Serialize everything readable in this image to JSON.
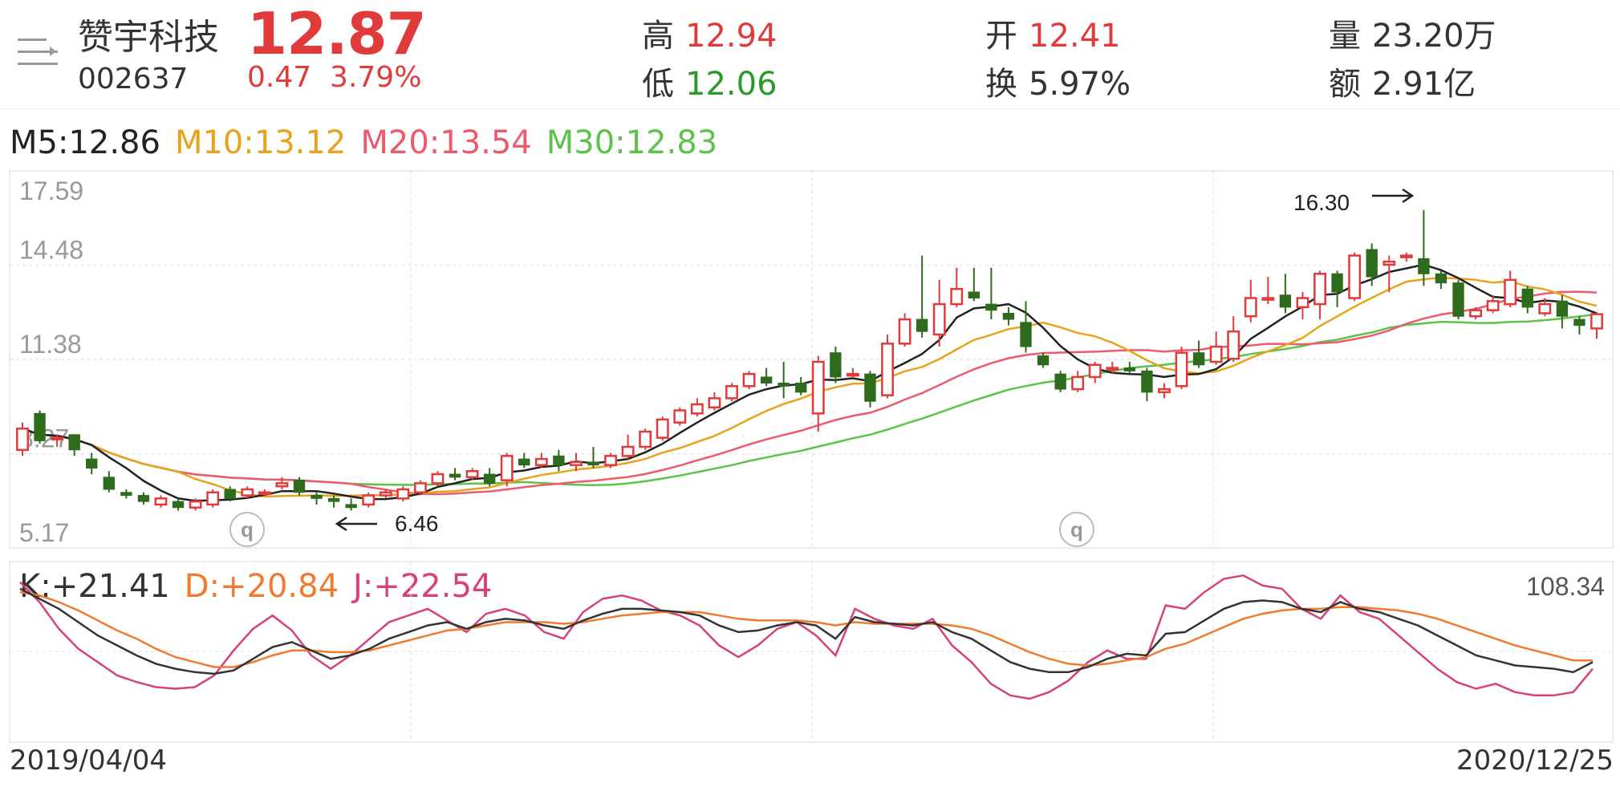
{
  "header": {
    "stock_name": "赞宇科技",
    "stock_code": "002637",
    "price": "12.87",
    "change": "0.47",
    "change_pct": "3.79%",
    "high_label": "高",
    "high": "12.94",
    "low_label": "低",
    "low": "12.06",
    "open_label": "开",
    "open": "12.41",
    "turnover_label": "换",
    "turnover": "5.97%",
    "volume_label": "量",
    "volume": "23.20万",
    "amount_label": "额",
    "amount": "2.91亿"
  },
  "ma_legend": {
    "m5": "M5:12.86",
    "m10": "M10:13.12",
    "m20": "M20:13.54",
    "m30": "M30:12.83"
  },
  "kdj_legend": {
    "k": "K:+21.41",
    "d": "D:+20.84",
    "j": "J:+22.54",
    "max": "108.34"
  },
  "dates": {
    "start": "2019/04/04",
    "end": "2020/12/25"
  },
  "annotations": {
    "high_mark": "16.30",
    "low_mark": "6.46",
    "q_badge": "q"
  },
  "colors": {
    "up": "#e03a3a",
    "down": "#2e6b1d",
    "m5": "#222222",
    "m10": "#e8a21c",
    "m20": "#ee5a6d",
    "m30": "#5cc24a",
    "k": "#333333",
    "d": "#f07a30",
    "j": "#d6407c"
  },
  "chart_data": {
    "type": "candlestick",
    "y_ticks": [
      "17.59",
      "14.48",
      "11.38",
      "8.27",
      "5.17"
    ],
    "ylim": [
      5.17,
      17.59
    ],
    "x_range": [
      "2019/04/04",
      "2020/12/25"
    ],
    "candles": [
      {
        "o": 8.4,
        "c": 9.1,
        "h": 9.3,
        "l": 8.2
      },
      {
        "o": 9.6,
        "c": 8.7,
        "h": 9.7,
        "l": 8.6
      },
      {
        "o": 8.8,
        "c": 8.8,
        "h": 8.9,
        "l": 8.5
      },
      {
        "o": 8.9,
        "c": 8.4,
        "h": 8.9,
        "l": 8.2
      },
      {
        "o": 8.1,
        "c": 7.8,
        "h": 8.3,
        "l": 7.6
      },
      {
        "o": 7.5,
        "c": 7.1,
        "h": 7.7,
        "l": 7.0
      },
      {
        "o": 7.0,
        "c": 6.9,
        "h": 7.1,
        "l": 6.8
      },
      {
        "o": 6.9,
        "c": 6.7,
        "h": 7.0,
        "l": 6.6
      },
      {
        "o": 6.6,
        "c": 6.8,
        "h": 6.9,
        "l": 6.5
      },
      {
        "o": 6.7,
        "c": 6.5,
        "h": 6.8,
        "l": 6.4
      },
      {
        "o": 6.5,
        "c": 6.7,
        "h": 6.8,
        "l": 6.4
      },
      {
        "o": 6.6,
        "c": 7.0,
        "h": 7.1,
        "l": 6.5
      },
      {
        "o": 7.1,
        "c": 6.8,
        "h": 7.2,
        "l": 6.7
      },
      {
        "o": 6.9,
        "c": 7.1,
        "h": 7.2,
        "l": 6.8
      },
      {
        "o": 7.0,
        "c": 7.0,
        "h": 7.1,
        "l": 6.9
      },
      {
        "o": 7.2,
        "c": 7.3,
        "h": 7.5,
        "l": 7.1
      },
      {
        "o": 7.4,
        "c": 7.0,
        "h": 7.5,
        "l": 6.9
      },
      {
        "o": 6.9,
        "c": 6.8,
        "h": 7.0,
        "l": 6.6
      },
      {
        "o": 6.8,
        "c": 6.7,
        "h": 6.9,
        "l": 6.5
      },
      {
        "o": 6.6,
        "c": 6.5,
        "h": 6.8,
        "l": 6.4
      },
      {
        "o": 6.6,
        "c": 6.9,
        "h": 7.0,
        "l": 6.5
      },
      {
        "o": 6.9,
        "c": 7.0,
        "h": 7.1,
        "l": 6.8
      },
      {
        "o": 6.8,
        "c": 7.1,
        "h": 7.2,
        "l": 6.7
      },
      {
        "o": 7.0,
        "c": 7.3,
        "h": 7.4,
        "l": 6.9
      },
      {
        "o": 7.3,
        "c": 7.6,
        "h": 7.7,
        "l": 7.2
      },
      {
        "o": 7.6,
        "c": 7.5,
        "h": 7.8,
        "l": 7.4
      },
      {
        "o": 7.5,
        "c": 7.7,
        "h": 7.8,
        "l": 7.4
      },
      {
        "o": 7.6,
        "c": 7.3,
        "h": 7.8,
        "l": 7.2
      },
      {
        "o": 7.4,
        "c": 8.2,
        "h": 8.3,
        "l": 7.2
      },
      {
        "o": 8.1,
        "c": 7.9,
        "h": 8.3,
        "l": 7.8
      },
      {
        "o": 7.9,
        "c": 8.1,
        "h": 8.3,
        "l": 7.8
      },
      {
        "o": 8.2,
        "c": 7.9,
        "h": 8.4,
        "l": 7.7
      },
      {
        "o": 7.9,
        "c": 8.0,
        "h": 8.3,
        "l": 7.7
      },
      {
        "o": 8.0,
        "c": 7.9,
        "h": 8.5,
        "l": 7.8
      },
      {
        "o": 7.9,
        "c": 8.2,
        "h": 8.3,
        "l": 7.8
      },
      {
        "o": 8.2,
        "c": 8.5,
        "h": 8.9,
        "l": 8.1
      },
      {
        "o": 8.5,
        "c": 9.0,
        "h": 9.1,
        "l": 8.4
      },
      {
        "o": 8.8,
        "c": 9.4,
        "h": 9.5,
        "l": 8.7
      },
      {
        "o": 9.3,
        "c": 9.7,
        "h": 9.8,
        "l": 9.2
      },
      {
        "o": 9.6,
        "c": 9.9,
        "h": 10.1,
        "l": 9.5
      },
      {
        "o": 9.8,
        "c": 10.1,
        "h": 10.3,
        "l": 9.7
      },
      {
        "o": 10.1,
        "c": 10.5,
        "h": 10.6,
        "l": 10.0
      },
      {
        "o": 10.5,
        "c": 10.9,
        "h": 11.0,
        "l": 10.4
      },
      {
        "o": 10.8,
        "c": 10.6,
        "h": 11.1,
        "l": 10.5
      },
      {
        "o": 10.6,
        "c": 10.5,
        "h": 11.3,
        "l": 10.1
      },
      {
        "o": 10.6,
        "c": 10.3,
        "h": 10.8,
        "l": 10.2
      },
      {
        "o": 9.6,
        "c": 11.3,
        "h": 11.5,
        "l": 9.0
      },
      {
        "o": 11.6,
        "c": 10.8,
        "h": 11.8,
        "l": 10.6
      },
      {
        "o": 10.9,
        "c": 10.9,
        "h": 11.1,
        "l": 10.8
      },
      {
        "o": 10.9,
        "c": 10.0,
        "h": 11.0,
        "l": 9.8
      },
      {
        "o": 10.2,
        "c": 11.9,
        "h": 12.2,
        "l": 10.1
      },
      {
        "o": 11.9,
        "c": 12.7,
        "h": 12.9,
        "l": 11.8
      },
      {
        "o": 12.7,
        "c": 12.3,
        "h": 14.8,
        "l": 12.1
      },
      {
        "o": 12.2,
        "c": 13.2,
        "h": 14.0,
        "l": 11.8
      },
      {
        "o": 13.2,
        "c": 13.7,
        "h": 14.4,
        "l": 13.1
      },
      {
        "o": 13.6,
        "c": 13.4,
        "h": 14.4,
        "l": 13.3
      },
      {
        "o": 13.2,
        "c": 13.0,
        "h": 14.4,
        "l": 12.7
      },
      {
        "o": 12.9,
        "c": 12.7,
        "h": 13.1,
        "l": 12.5
      },
      {
        "o": 12.6,
        "c": 11.8,
        "h": 13.3,
        "l": 11.6
      },
      {
        "o": 11.5,
        "c": 11.2,
        "h": 11.6,
        "l": 11.1
      },
      {
        "o": 10.9,
        "c": 10.4,
        "h": 11.0,
        "l": 10.3
      },
      {
        "o": 10.4,
        "c": 10.8,
        "h": 11.0,
        "l": 10.3
      },
      {
        "o": 10.8,
        "c": 11.2,
        "h": 11.3,
        "l": 10.6
      },
      {
        "o": 11.1,
        "c": 11.1,
        "h": 11.3,
        "l": 10.9
      },
      {
        "o": 11.1,
        "c": 11.0,
        "h": 11.3,
        "l": 10.9
      },
      {
        "o": 11.0,
        "c": 10.3,
        "h": 11.1,
        "l": 10.0
      },
      {
        "o": 10.3,
        "c": 10.4,
        "h": 10.6,
        "l": 10.1
      },
      {
        "o": 10.5,
        "c": 11.6,
        "h": 11.8,
        "l": 10.4
      },
      {
        "o": 11.6,
        "c": 11.2,
        "h": 12.0,
        "l": 11.1
      },
      {
        "o": 11.3,
        "c": 11.8,
        "h": 12.3,
        "l": 11.2
      },
      {
        "o": 11.4,
        "c": 12.3,
        "h": 12.8,
        "l": 11.3
      },
      {
        "o": 12.8,
        "c": 13.4,
        "h": 14.0,
        "l": 12.6
      },
      {
        "o": 13.4,
        "c": 13.4,
        "h": 14.1,
        "l": 13.2
      },
      {
        "o": 13.5,
        "c": 13.1,
        "h": 14.2,
        "l": 12.9
      },
      {
        "o": 13.1,
        "c": 13.4,
        "h": 13.6,
        "l": 12.7
      },
      {
        "o": 13.2,
        "c": 14.2,
        "h": 14.3,
        "l": 12.7
      },
      {
        "o": 14.2,
        "c": 13.6,
        "h": 14.3,
        "l": 13.1
      },
      {
        "o": 13.4,
        "c": 14.8,
        "h": 14.9,
        "l": 13.3
      },
      {
        "o": 15.0,
        "c": 14.1,
        "h": 15.2,
        "l": 13.8
      },
      {
        "o": 14.5,
        "c": 14.6,
        "h": 14.8,
        "l": 13.6
      },
      {
        "o": 14.8,
        "c": 14.8,
        "h": 14.9,
        "l": 14.6
      },
      {
        "o": 14.7,
        "c": 14.2,
        "h": 16.3,
        "l": 13.8
      },
      {
        "o": 14.2,
        "c": 13.9,
        "h": 14.3,
        "l": 13.7
      },
      {
        "o": 13.9,
        "c": 12.8,
        "h": 14.0,
        "l": 12.7
      },
      {
        "o": 12.8,
        "c": 13.0,
        "h": 13.1,
        "l": 12.7
      },
      {
        "o": 13.0,
        "c": 13.3,
        "h": 13.5,
        "l": 12.9
      },
      {
        "o": 13.2,
        "c": 14.0,
        "h": 14.3,
        "l": 13.1
      },
      {
        "o": 13.7,
        "c": 13.1,
        "h": 13.8,
        "l": 12.9
      },
      {
        "o": 12.9,
        "c": 13.2,
        "h": 13.4,
        "l": 12.8
      },
      {
        "o": 13.3,
        "c": 12.8,
        "h": 13.5,
        "l": 12.4
      },
      {
        "o": 12.7,
        "c": 12.5,
        "h": 12.8,
        "l": 12.2
      },
      {
        "o": 12.4,
        "c": 12.87,
        "h": 12.94,
        "l": 12.06
      }
    ],
    "kdj": {
      "k": [
        92,
        86,
        80,
        72,
        64,
        58,
        52,
        47,
        44,
        42,
        41,
        43,
        50,
        57,
        60,
        55,
        50,
        52,
        56,
        62,
        66,
        70,
        72,
        68,
        72,
        74,
        73,
        70,
        68,
        73,
        77,
        80,
        80,
        79,
        78,
        76,
        70,
        66,
        67,
        70,
        72,
        70,
        62,
        75,
        72,
        71,
        70,
        72,
        66,
        62,
        55,
        48,
        44,
        42,
        42,
        45,
        50,
        53,
        52,
        65,
        66,
        73,
        80,
        84,
        85,
        84,
        80,
        78,
        84,
        80,
        78,
        74,
        70,
        64,
        58,
        52,
        49,
        46,
        45,
        44,
        42,
        48
      ],
      "d": [
        90,
        88,
        84,
        79,
        73,
        67,
        62,
        56,
        51,
        48,
        45,
        45,
        48,
        52,
        55,
        55,
        54,
        54,
        55,
        58,
        61,
        64,
        67,
        68,
        70,
        72,
        72,
        72,
        71,
        72,
        74,
        76,
        77,
        78,
        78,
        78,
        76,
        74,
        73,
        73,
        73,
        72,
        70,
        72,
        71,
        71,
        71,
        71,
        70,
        68,
        64,
        59,
        54,
        50,
        47,
        46,
        47,
        49,
        51,
        56,
        59,
        64,
        69,
        74,
        77,
        79,
        80,
        80,
        81,
        81,
        80,
        79,
        77,
        74,
        70,
        66,
        62,
        58,
        55,
        52,
        49,
        49
      ],
      "j": [
        96,
        84,
        68,
        56,
        48,
        40,
        36,
        33,
        32,
        33,
        40,
        55,
        68,
        76,
        67,
        52,
        44,
        52,
        62,
        72,
        76,
        80,
        73,
        66,
        77,
        80,
        76,
        66,
        62,
        78,
        86,
        88,
        85,
        79,
        76,
        70,
        58,
        51,
        58,
        68,
        72,
        64,
        52,
        80,
        74,
        70,
        68,
        74,
        58,
        48,
        35,
        28,
        26,
        30,
        37,
        48,
        55,
        50,
        50,
        82,
        80,
        90,
        98,
        100,
        94,
        92,
        80,
        74,
        88,
        78,
        74,
        64,
        54,
        44,
        36,
        32,
        35,
        30,
        28,
        28,
        30,
        44
      ]
    },
    "kdj_ylim": [
      0,
      108.34
    ]
  }
}
